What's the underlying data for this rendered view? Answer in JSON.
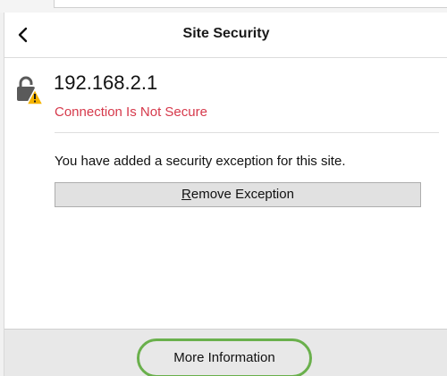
{
  "header": {
    "title": "Site Security",
    "back_icon": "chevron-left-icon"
  },
  "site": {
    "host": "192.168.2.1",
    "status": "Connection Is Not Secure",
    "status_color": "#d6394b",
    "lock_icon": "lock-warning-icon"
  },
  "exception": {
    "message": "You have added a security exception for this site.",
    "remove_button_mnemonic": "R",
    "remove_button_rest": "emove Exception"
  },
  "footer": {
    "more_info_label": "More Information",
    "highlight_color": "#6ab04c"
  }
}
